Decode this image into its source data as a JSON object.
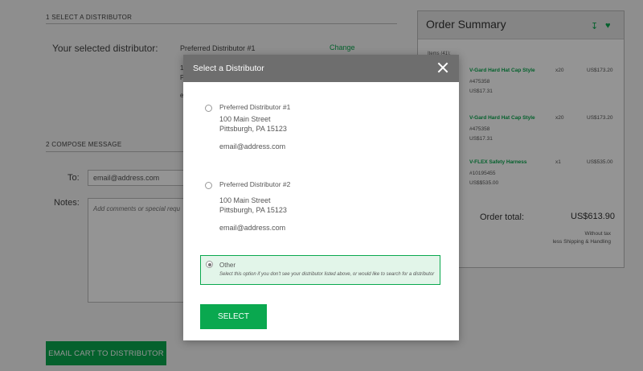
{
  "steps": {
    "select_distributor": "1 SELECT A DISTRIBUTOR",
    "compose_message": "2 COMPOSE MESSAGE"
  },
  "selected": {
    "label": "Your selected distributor:",
    "value": "Preferred Distributor #1",
    "change_link": "Change",
    "peek_line_1": "1",
    "peek_line_2": "P",
    "peek_line_3": "e"
  },
  "compose": {
    "to_label": "To:",
    "to_value": "email@address.com",
    "notes_label": "Notes:",
    "notes_placeholder": "Add comments or special requ"
  },
  "email_cart_button": "EMAIL CART TO DISTRIBUTOR",
  "order_summary": {
    "title": "Order Summary",
    "icons": [
      "download-icon",
      "heart-icon"
    ],
    "items_count": "Items (41):",
    "items": [
      {
        "name": "V-Gard Hard Hat Cap Style",
        "sku": "#475358",
        "unit_price": "US$17.31",
        "qty": "x20",
        "total": "US$173.20"
      },
      {
        "name": "V-Gard Hard Hat Cap Style",
        "sku": "#475358",
        "unit_price": "US$17.31",
        "qty": "x20",
        "total": "US$173.20"
      },
      {
        "name": "V-FLEX Safety Harness",
        "sku": "#10195455",
        "unit_price": "US$$535.00",
        "qty": "x1",
        "total": "US$535.00"
      }
    ],
    "total_label": "Order total:",
    "total_value": "US$613.90",
    "tax_note_1": "Without tax",
    "tax_note_2": "less Shipping & Handling"
  },
  "modal": {
    "title": "Select a Distributor",
    "close_icon": "close-icon",
    "options": [
      {
        "name": "Preferred Distributor #1",
        "street": "100 Main Street",
        "city": "Pittsburgh, PA 15123",
        "email": "email@address.com",
        "selected": false
      },
      {
        "name": "Preferred Distributor #2",
        "street": "100 Main Street",
        "city": "Pittsburgh, PA 15123",
        "email": "email@address.com",
        "selected": false
      }
    ],
    "other": {
      "name": "Other",
      "description": "Select this option if you don't see your distributor listed above, or would like to search for a distributor",
      "selected": true
    },
    "select_button": "SELECT"
  },
  "colors": {
    "accent": "#0aa84f",
    "modal_header": "#6e6e6e",
    "other_bg": "#e2f5e9"
  }
}
